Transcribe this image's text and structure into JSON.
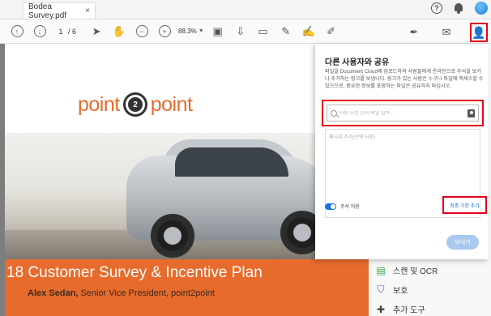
{
  "tab": {
    "title": "Bodea Survey.pdf",
    "close": "×"
  },
  "topbar": {
    "help": "?"
  },
  "toolbar": {
    "page_current": "1",
    "page_total": "/ 6",
    "zoom": "88.3%"
  },
  "document": {
    "logo_left": "point",
    "logo_center": "2",
    "logo_right": "point",
    "banner_title": "18 Customer Survey & Incentive Plan",
    "presenter_name": "Alex Sedan,",
    "presenter_role": " Senior Vice President, point2point"
  },
  "share_panel": {
    "title": "다른 사용자와 공유",
    "description": "파일을 Document Cloud에 업로드하여 사람들에게 온라인으로 주석을 보거나 추가하는 링크를 보냅니다. 링크가 있는 사람은 누구나 파일에 액세스할 수 있으므로, 중요한 정보를 포함하는 파일은 공유하지 마십시오.",
    "email_placeholder": "이름 또는 전자 메일 입력...",
    "message_placeholder": "메시지 추가(선택 사항)",
    "comments_label": "주석 허용",
    "deadline_link": "최종 기한 추가",
    "send_button": "보내기"
  },
  "tools_pane": {
    "items": [
      {
        "label": "스캔 및 OCR"
      },
      {
        "label": "보호"
      },
      {
        "label": "추가 도구"
      }
    ]
  },
  "colors": {
    "accent": "#1473e6",
    "highlight": "#e3001b",
    "brand_orange": "#e76b2c"
  }
}
